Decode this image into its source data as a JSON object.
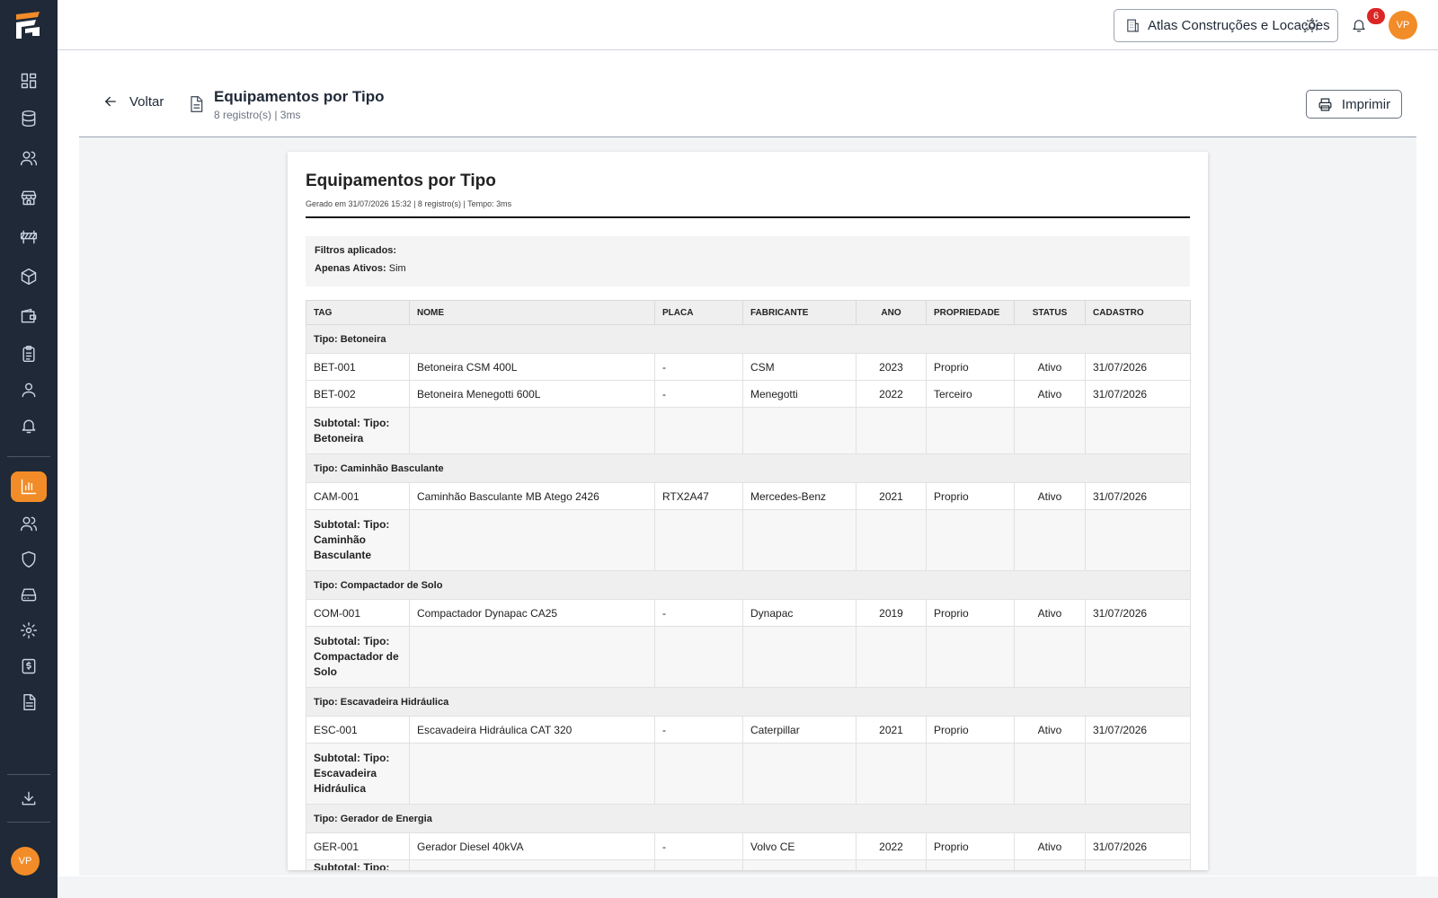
{
  "sidebar": {
    "items": [
      {
        "icon": "dashboard-icon"
      },
      {
        "icon": "database-icon"
      },
      {
        "icon": "users-icon"
      },
      {
        "icon": "store-icon"
      },
      {
        "icon": "road-barrier-icon"
      },
      {
        "icon": "box-icon"
      },
      {
        "icon": "wallet-icon"
      },
      {
        "icon": "clipboard-list-icon"
      },
      {
        "icon": "user-icon"
      },
      {
        "icon": "bell-icon"
      },
      {
        "icon": "bar-chart-icon",
        "active": true
      },
      {
        "icon": "users-icon"
      },
      {
        "icon": "shield-icon"
      },
      {
        "icon": "hard-drive-icon"
      },
      {
        "icon": "settings-icon"
      },
      {
        "icon": "receipt-icon"
      },
      {
        "icon": "file-text-icon"
      },
      {
        "icon": "download-icon"
      }
    ],
    "avatar_initials": "VP",
    "accent_color": "#f28c28"
  },
  "topbar": {
    "company": "Atlas Construções e Locações",
    "notifications_count": "6",
    "avatar_initials": "VP"
  },
  "header": {
    "back_label": "Voltar",
    "title": "Equipamentos por Tipo",
    "subtitle": "8 registro(s) | 3ms",
    "print_label": "Imprimir"
  },
  "report": {
    "title": "Equipamentos por Tipo",
    "generated": "Gerado em 31/07/2026 15:32 | 8 registro(s) | Tempo: 3ms",
    "filters_label": "Filtros aplicados:",
    "filter_name": "Apenas Ativos:",
    "filter_value": "Sim",
    "columns": [
      "TAG",
      "NOME",
      "PLACA",
      "FABRICANTE",
      "ANO",
      "PROPRIEDADE",
      "STATUS",
      "CADASTRO"
    ],
    "groups": [
      {
        "label": "Tipo: Betoneira",
        "rows": [
          [
            "BET-001",
            "Betoneira CSM 400L",
            "-",
            "CSM",
            "2023",
            "Proprio",
            "Ativo",
            "31/07/2026"
          ],
          [
            "BET-002",
            "Betoneira Menegotti 600L",
            "-",
            "Menegotti",
            "2022",
            "Terceiro",
            "Ativo",
            "31/07/2026"
          ]
        ],
        "subtotal": "Subtotal: Tipo: Betoneira"
      },
      {
        "label": "Tipo: Caminhão Basculante",
        "rows": [
          [
            "CAM-001",
            "Caminhão Basculante MB Atego 2426",
            "RTX2A47",
            "Mercedes-Benz",
            "2021",
            "Proprio",
            "Ativo",
            "31/07/2026"
          ]
        ],
        "subtotal": "Subtotal: Tipo: Caminhão Basculante"
      },
      {
        "label": "Tipo: Compactador de Solo",
        "rows": [
          [
            "COM-001",
            "Compactador Dynapac CA25",
            "-",
            "Dynapac",
            "2019",
            "Proprio",
            "Ativo",
            "31/07/2026"
          ]
        ],
        "subtotal": "Subtotal: Tipo: Compactador de Solo"
      },
      {
        "label": "Tipo: Escavadeira Hidráulica",
        "rows": [
          [
            "ESC-001",
            "Escavadeira Hidráulica CAT 320",
            "-",
            "Caterpillar",
            "2021",
            "Proprio",
            "Ativo",
            "31/07/2026"
          ]
        ],
        "subtotal": "Subtotal: Tipo: Escavadeira Hidráulica"
      },
      {
        "label": "Tipo: Gerador de Energia",
        "rows": [
          [
            "GER-001",
            "Gerador Diesel 40kVA",
            "-",
            "Volvo CE",
            "2022",
            "Proprio",
            "Ativo",
            "31/07/2026"
          ]
        ],
        "subtotal": "Subtotal: Tipo: Gerador de Energia"
      }
    ]
  }
}
